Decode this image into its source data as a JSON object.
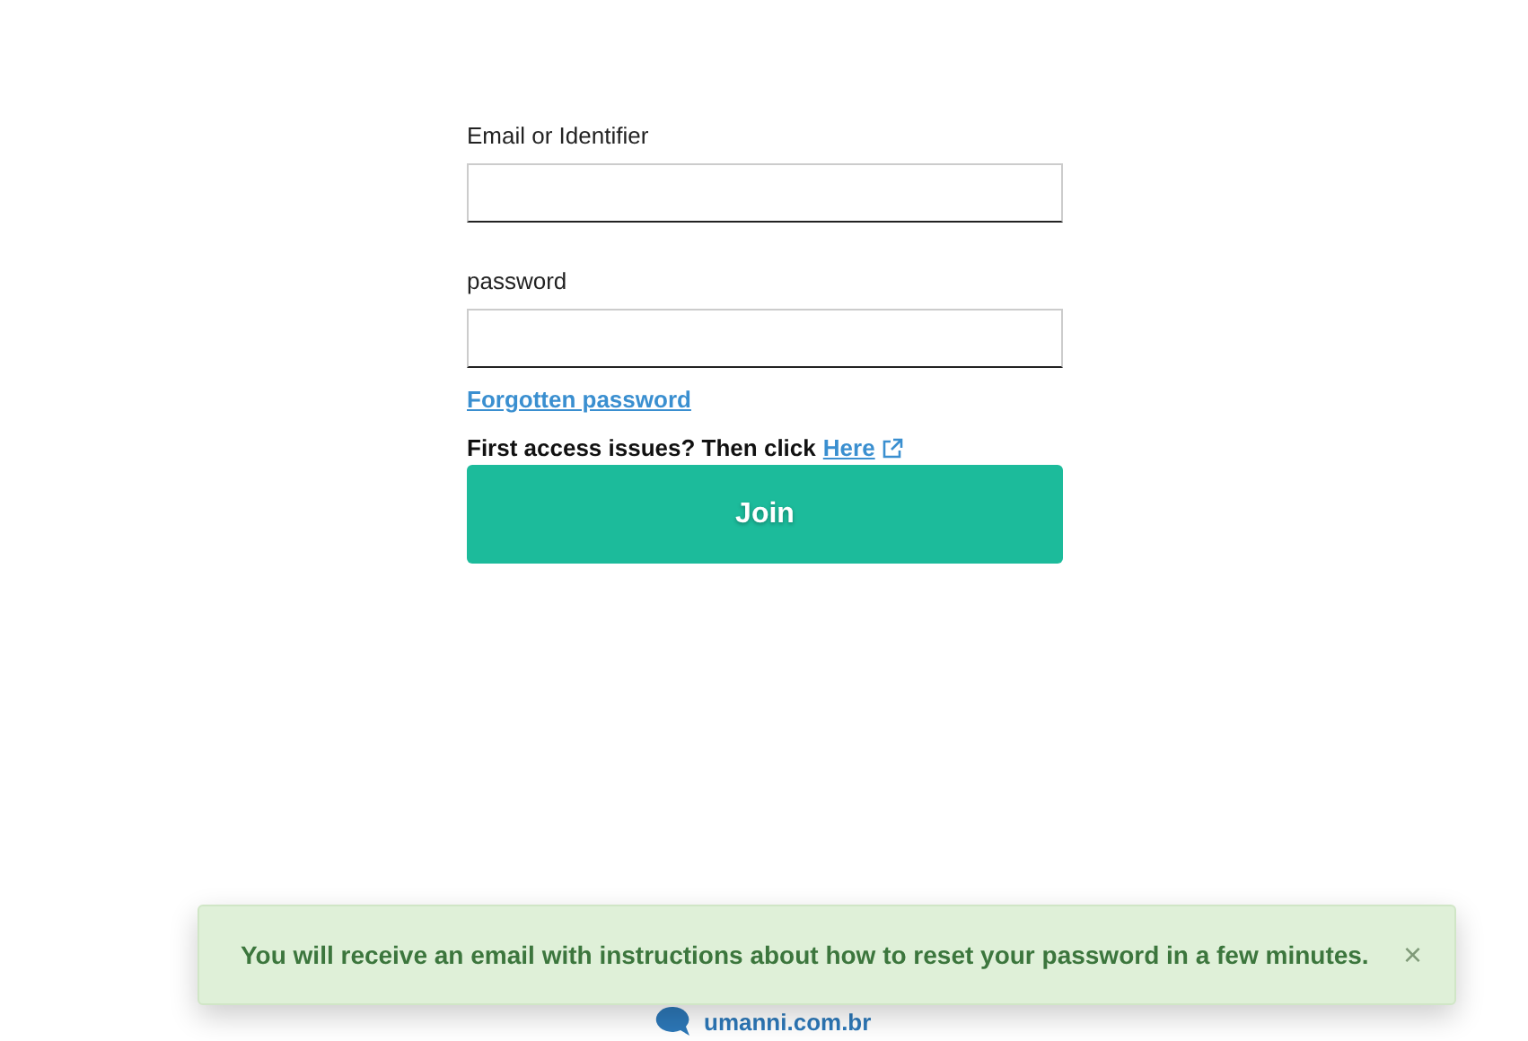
{
  "form": {
    "fields": [
      {
        "label": "Email or Identifier"
      },
      {
        "label": "password"
      }
    ],
    "forgot_link": "Forgotten password",
    "first_access": {
      "text": "First access issues? Then click",
      "link": "Here"
    },
    "submit": "Join"
  },
  "footer": {
    "text": "umanni.com.br"
  },
  "toast": {
    "message": "You will receive an email with instructions about how to reset your password in a few minutes.",
    "close": "×"
  }
}
